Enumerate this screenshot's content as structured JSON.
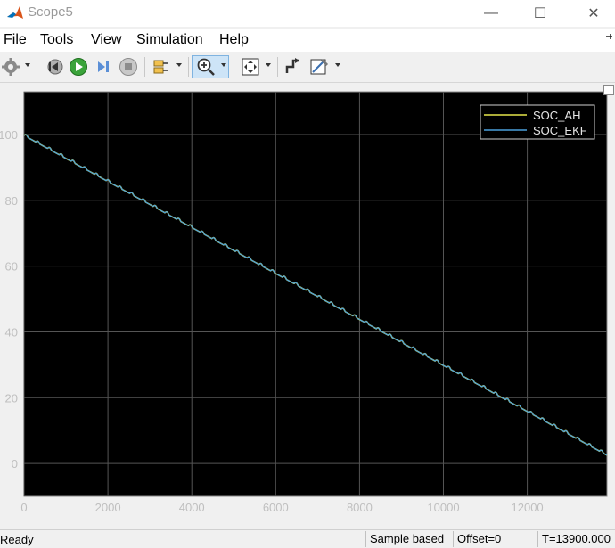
{
  "window": {
    "title": "Scope5",
    "minimize_glyph": "—",
    "maximize_glyph": "☐",
    "close_glyph": "✕"
  },
  "menu": {
    "items": [
      "File",
      "Tools",
      "View",
      "Simulation",
      "Help"
    ]
  },
  "toolbar": {
    "icons": [
      "gear-icon",
      "step-back-icon",
      "run-icon",
      "step-forward-icon",
      "stop-icon",
      "signal-selector-icon",
      "zoom-in-icon",
      "fit-to-view-icon",
      "triggers-icon",
      "cursor-measurements-icon"
    ]
  },
  "status": {
    "ready": "Ready",
    "mode": "Sample based",
    "offset": "Offset=0",
    "time": "T=13900.000"
  },
  "colors": {
    "plot_bg": "#000000",
    "grid": "#555555",
    "ah": "#e6e64a",
    "ekf": "#4a9fdc",
    "axis_text": "#bfbfbf"
  },
  "chart_data": {
    "type": "line",
    "xlim": [
      0,
      13900
    ],
    "ylim": [
      -10,
      113
    ],
    "xticks": [
      0,
      2000,
      4000,
      6000,
      8000,
      10000,
      12000
    ],
    "yticks": [
      0,
      20,
      40,
      60,
      80,
      100
    ],
    "grid": true,
    "legend_position": "top-right",
    "series": [
      {
        "name": "SOC_AH",
        "x": [
          0,
          13900
        ],
        "y": [
          100,
          2.8
        ]
      },
      {
        "name": "SOC_EKF",
        "x": [
          0,
          13900
        ],
        "y": [
          100,
          2.8
        ]
      }
    ]
  }
}
